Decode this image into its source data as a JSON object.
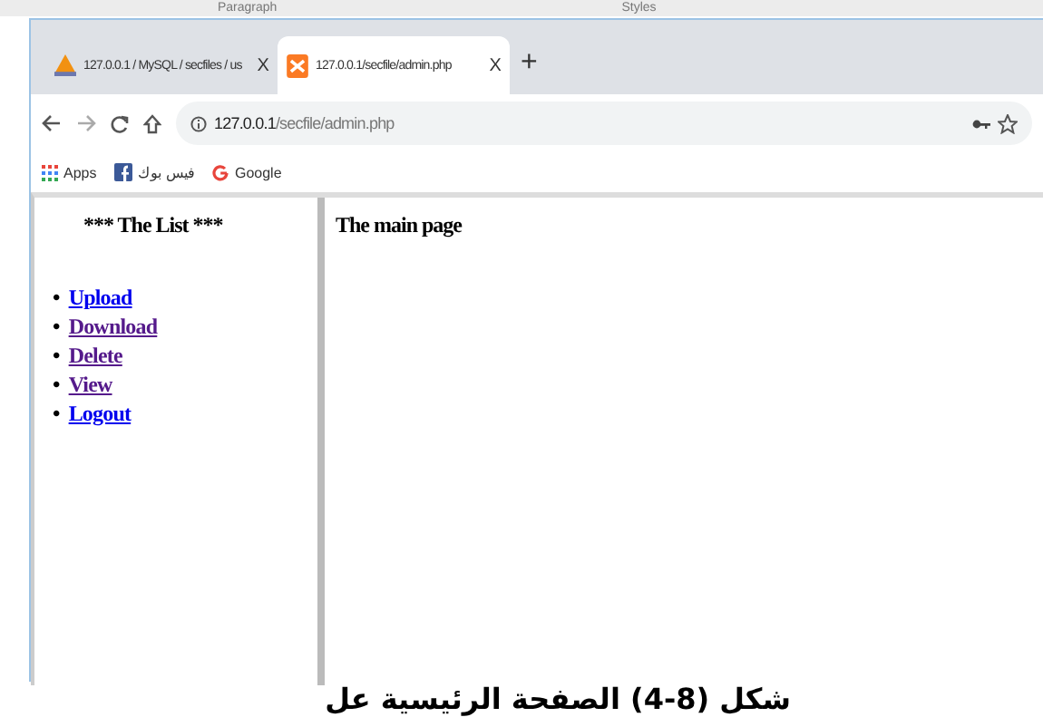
{
  "ribbon": {
    "labels": [
      "Paragraph",
      "Styles"
    ]
  },
  "tabs": [
    {
      "title": "127.0.0.1 / MySQL / secfiles / us",
      "selected": false,
      "kind": "pma",
      "close": "X"
    },
    {
      "title": "127.0.0.1/secfile/admin.php",
      "selected": true,
      "kind": "xampp",
      "close": "X"
    }
  ],
  "new_tab": "+",
  "address": {
    "host": "127.0.0.1",
    "path": "/secfile/admin.php"
  },
  "bookmarks": [
    {
      "label": "Apps",
      "kind": "apps"
    },
    {
      "label": "فيس بوك",
      "kind": "facebook"
    },
    {
      "label": "Google",
      "kind": "google"
    }
  ],
  "left_frame": {
    "heading": "*** The List ***",
    "marker": "•",
    "links": [
      {
        "label": "Upload",
        "visited": false
      },
      {
        "label": "Download",
        "visited": true
      },
      {
        "label": "Delete",
        "visited": true
      },
      {
        "label": "View",
        "visited": true
      },
      {
        "label": "Logout",
        "visited": false
      }
    ]
  },
  "main_frame": {
    "heading": "The main page"
  },
  "caption": "شكل (8-4) الصفحة الرئيسية عل"
}
